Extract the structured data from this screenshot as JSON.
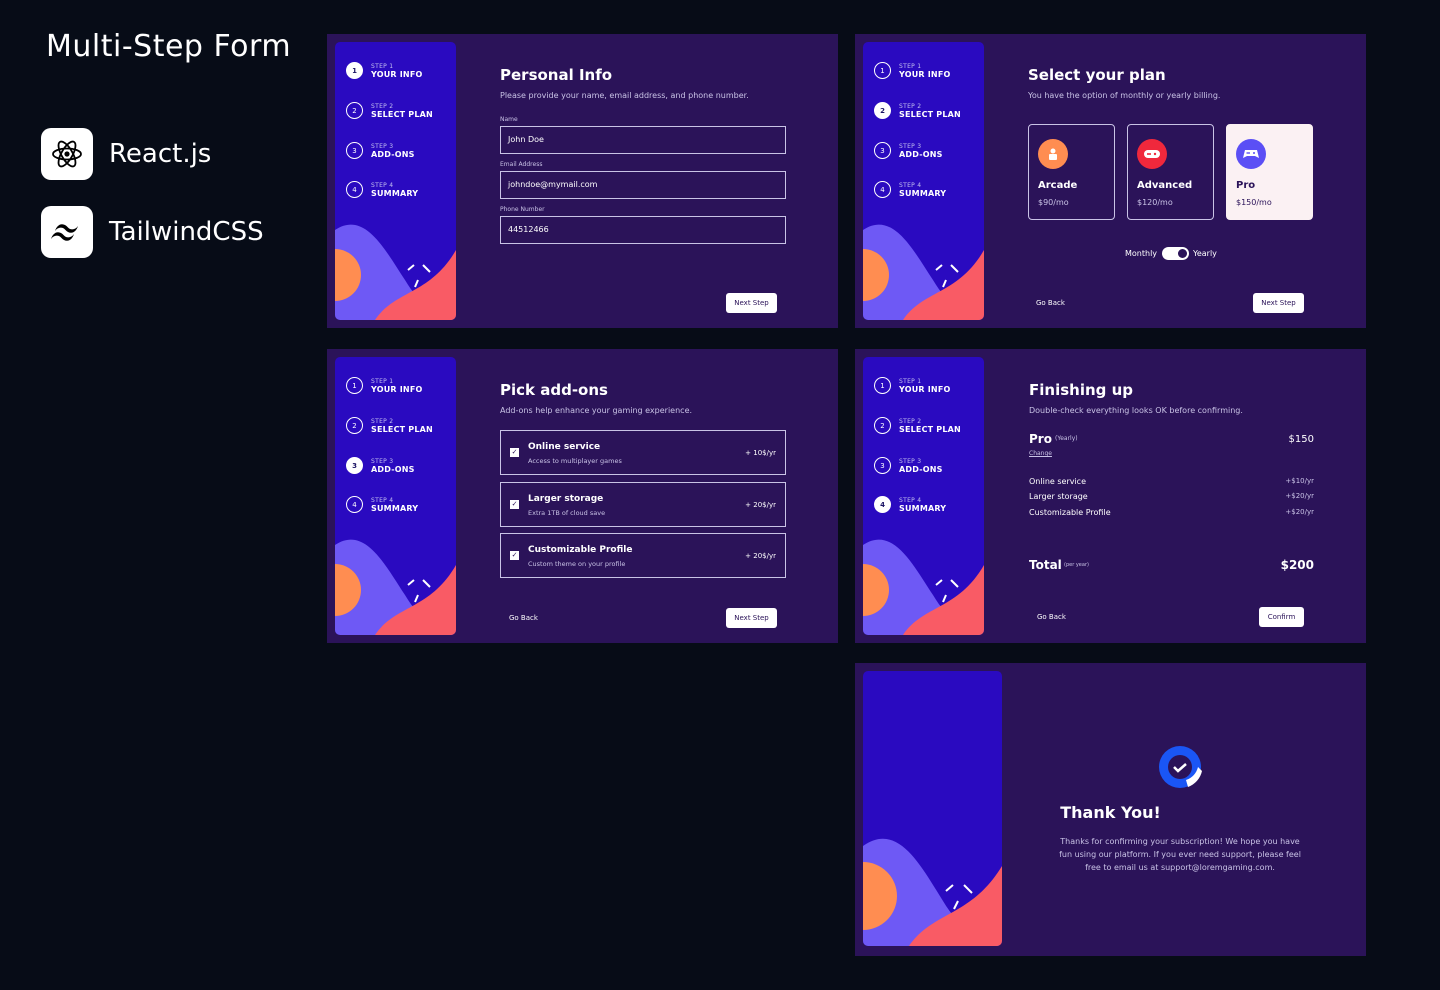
{
  "header": {
    "title": "Multi-Step Form"
  },
  "tech": [
    {
      "label": "React.js",
      "icon": "react-icon"
    },
    {
      "label": "TailwindCSS",
      "icon": "tailwind-icon"
    }
  ],
  "steps": [
    {
      "num": "1",
      "name": "STEP 1",
      "label": "YOUR INFO"
    },
    {
      "num": "2",
      "name": "STEP 2",
      "label": "SELECT PLAN"
    },
    {
      "num": "3",
      "name": "STEP 3",
      "label": "ADD-ONS"
    },
    {
      "num": "4",
      "name": "STEP 4",
      "label": "SUMMARY"
    }
  ],
  "colors": {
    "background": "#070c17",
    "panel": "#2b1359",
    "sidebar": "#2a0ac0",
    "coral": "#f95b65",
    "orange": "#ff8d51",
    "purple": "#6e59f5"
  },
  "personal": {
    "title": "Personal Info",
    "subtitle": "Please provide your name, email address, and phone number.",
    "fields": [
      {
        "label": "Name",
        "value": "John Doe"
      },
      {
        "label": "Email Address",
        "value": "johndoe@mymail.com"
      },
      {
        "label": "Phone Number",
        "value": "44512466"
      }
    ],
    "next": "Next Step"
  },
  "plan": {
    "title": "Select your plan",
    "subtitle": "You have the option of monthly or yearly billing.",
    "plans": [
      {
        "name": "Arcade",
        "price": "$90/mo",
        "icon": "arcade-icon",
        "color": "#ff8d51"
      },
      {
        "name": "Advanced",
        "price": "$120/mo",
        "icon": "gamepad-icon",
        "color": "#f0283c"
      },
      {
        "name": "Pro",
        "price": "$150/mo",
        "icon": "controller-icon",
        "color": "#5b4ff5"
      }
    ],
    "selected": "Pro",
    "monthly": "Monthly",
    "yearly": "Yearly",
    "back": "Go Back",
    "next": "Next Step"
  },
  "addons": {
    "title": "Pick add-ons",
    "subtitle": "Add-ons help enhance your gaming experience.",
    "items": [
      {
        "name": "Online service",
        "desc": "Access to multiplayer games",
        "price": "+ 10$/yr"
      },
      {
        "name": "Larger storage",
        "desc": "Extra 1TB of cloud save",
        "price": "+ 20$/yr"
      },
      {
        "name": "Customizable Profile",
        "desc": "Custom theme on your profile",
        "price": "+ 20$/yr"
      }
    ],
    "back": "Go Back",
    "next": "Next Step"
  },
  "summary": {
    "title": "Finishing up",
    "subtitle": "Double-check everything looks OK before confirming.",
    "plan_name": "Pro",
    "plan_period": "(Yearly)",
    "plan_price": "$150",
    "change": "Change",
    "items": [
      {
        "name": "Online service",
        "price": "+$10/yr"
      },
      {
        "name": "Larger storage",
        "price": "+$20/yr"
      },
      {
        "name": "Customizable Profile",
        "price": "+$20/yr"
      }
    ],
    "total_label": "Total",
    "total_period": "(per year)",
    "total": "$200",
    "back": "Go Back",
    "confirm": "Confirm"
  },
  "thanks": {
    "title": "Thank You!",
    "message": "Thanks for confirming your subscription! We hope you have fun using our platform. If you ever need support, please feel free to email us at support@loremgaming.com."
  }
}
